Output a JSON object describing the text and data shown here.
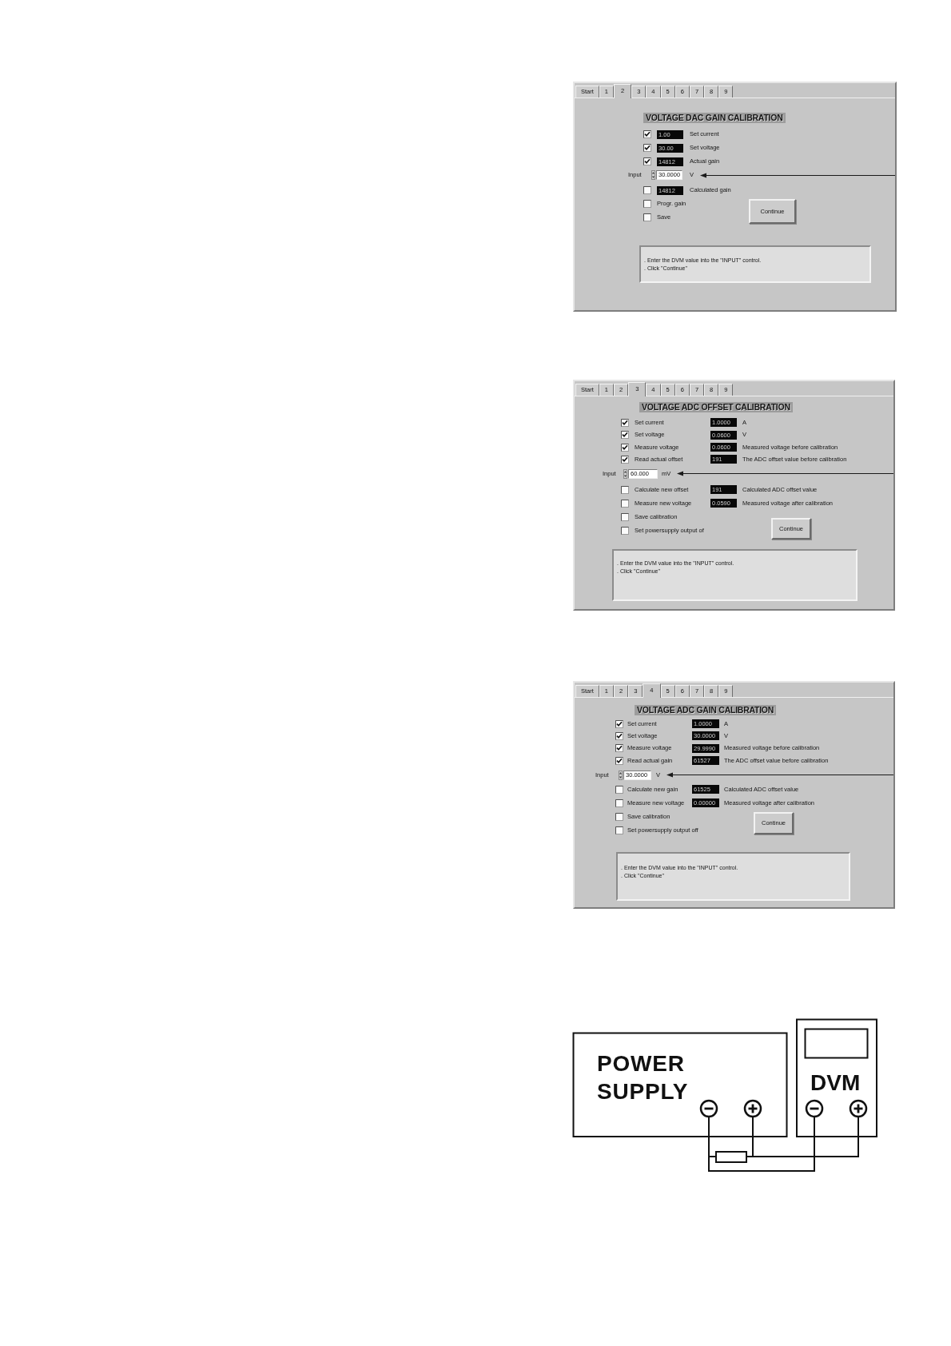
{
  "panels": [
    {
      "kind": "narrow",
      "tabs": [
        {
          "label": "Start",
          "selected": false
        },
        {
          "label": "1",
          "selected": false
        },
        {
          "label": "2",
          "selected": true
        },
        {
          "label": "3",
          "selected": false
        },
        {
          "label": "4",
          "selected": false
        },
        {
          "label": "5",
          "selected": false
        },
        {
          "label": "6",
          "selected": false
        },
        {
          "label": "7",
          "selected": false
        },
        {
          "label": "8",
          "selected": false
        },
        {
          "label": "9",
          "selected": false
        }
      ],
      "title": "VOLTAGE DAC GAIN CALIBRATION",
      "rows": [
        {
          "kind": "step",
          "checked": true,
          "label": "Set current",
          "reading": "1.00"
        },
        {
          "kind": "step",
          "checked": true,
          "label": "Set voltage",
          "reading": "30.00"
        },
        {
          "kind": "step",
          "checked": true,
          "label": "Actual gain",
          "reading": "14812"
        },
        {
          "kind": "input",
          "label": "Input",
          "value": "30.0000",
          "unit": "V"
        },
        {
          "kind": "step",
          "checked": false,
          "label": "Calculated gain",
          "reading": "14812"
        },
        {
          "kind": "step",
          "checked": false,
          "label": "Progr. gain"
        },
        {
          "kind": "step",
          "checked": false,
          "label": "Save"
        }
      ],
      "button": "Continue",
      "message": [
        ". Enter the DVM value into the \"INPUT\" control.",
        ". Click \"Continue\""
      ]
    },
    {
      "kind": "wide",
      "tabs": [
        {
          "label": "Start",
          "selected": false
        },
        {
          "label": "1",
          "selected": false
        },
        {
          "label": "2",
          "selected": false
        },
        {
          "label": "3",
          "selected": true
        },
        {
          "label": "4",
          "selected": false
        },
        {
          "label": "5",
          "selected": false
        },
        {
          "label": "6",
          "selected": false
        },
        {
          "label": "7",
          "selected": false
        },
        {
          "label": "8",
          "selected": false
        },
        {
          "label": "9",
          "selected": false
        }
      ],
      "title": "VOLTAGE ADC OFFSET CALIBRATION",
      "rows": [
        {
          "kind": "step",
          "checked": true,
          "label": "Set current",
          "reading": "1.0000",
          "note": "A"
        },
        {
          "kind": "step",
          "checked": true,
          "label": "Set voltage",
          "reading": "0.0600",
          "note": "V"
        },
        {
          "kind": "step",
          "checked": true,
          "label": "Measure voltage",
          "reading": "0.0600",
          "note": "Measured voltage before calibration"
        },
        {
          "kind": "step",
          "checked": true,
          "label": "Read actual offset",
          "reading": "191",
          "note": "The ADC offset value before calibration"
        },
        {
          "kind": "input",
          "label": "Input",
          "value": "60.000",
          "unit": "mV"
        },
        {
          "kind": "step",
          "checked": false,
          "label": "Calculate new offset",
          "reading": "191",
          "note": "Calculated ADC offset value"
        },
        {
          "kind": "step",
          "checked": false,
          "label": "Measure new voltage",
          "reading": "0.0590",
          "note": "Measured voltage after calibration"
        },
        {
          "kind": "step",
          "checked": false,
          "label": "Save calibration"
        },
        {
          "kind": "step",
          "checked": false,
          "label": "Set powersupply output of"
        }
      ],
      "button": "Continue",
      "message": [
        ". Enter the DVM value into the \"INPUT\" control.",
        ". Click \"Continue\""
      ]
    },
    {
      "kind": "wide",
      "tabs": [
        {
          "label": "Start",
          "selected": false
        },
        {
          "label": "1",
          "selected": false
        },
        {
          "label": "2",
          "selected": false
        },
        {
          "label": "3",
          "selected": false
        },
        {
          "label": "4",
          "selected": true
        },
        {
          "label": "5",
          "selected": false
        },
        {
          "label": "6",
          "selected": false
        },
        {
          "label": "7",
          "selected": false
        },
        {
          "label": "8",
          "selected": false
        },
        {
          "label": "9",
          "selected": false
        }
      ],
      "title": "VOLTAGE ADC GAIN CALIBRATION",
      "rows": [
        {
          "kind": "step",
          "checked": true,
          "label": "Set current",
          "reading": "1.0000",
          "note": "A"
        },
        {
          "kind": "step",
          "checked": true,
          "label": "Set voltage",
          "reading": "30.0000",
          "note": "V"
        },
        {
          "kind": "step",
          "checked": true,
          "label": "Measure voltage",
          "reading": "29.9990",
          "note": "Measured voltage before calibration"
        },
        {
          "kind": "step",
          "checked": true,
          "label": "Read actual gain",
          "reading": "61527",
          "note": "The ADC offset value before calibration"
        },
        {
          "kind": "input",
          "label": "Input",
          "value": "30.0000",
          "unit": "V"
        },
        {
          "kind": "step",
          "checked": false,
          "label": "Calculate new gain",
          "reading": "61525",
          "note": "Calculated ADC offset value"
        },
        {
          "kind": "step",
          "checked": false,
          "label": "Measure new voltage",
          "reading": "0.00000",
          "note": "Measured voltage after calibration"
        },
        {
          "kind": "step",
          "checked": false,
          "label": "Save calibration"
        },
        {
          "kind": "step",
          "checked": false,
          "label": "Set powersupply output off"
        }
      ],
      "button": "Continue",
      "message": [
        ". Enter the DVM value into the \"INPUT\" control.",
        ". Click \"Continue\""
      ]
    }
  ],
  "diagram": {
    "supply_label": [
      "POWER",
      "SUPPLY"
    ],
    "meter_label": "DVM"
  }
}
